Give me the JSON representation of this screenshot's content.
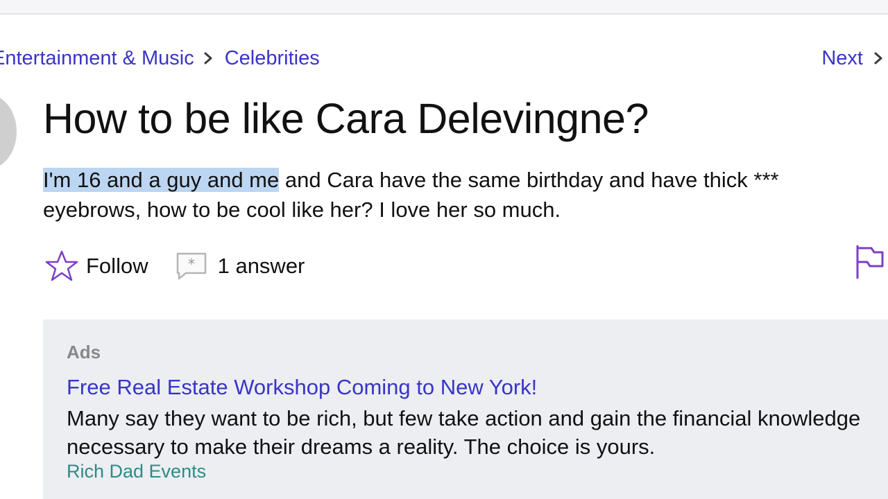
{
  "breadcrumb": {
    "parent": "Entertainment & Music",
    "current": "Celebrities"
  },
  "nav": {
    "next_label": "Next"
  },
  "question": {
    "title": "How to be like Cara Delevingne?",
    "body_selected": "I'm 16 and a guy and me",
    "body_rest": " and Cara have the same birthday and have thick *** eyebrows, how to be cool like her? I love her so much."
  },
  "actions": {
    "follow_label": "Follow",
    "answers_label": "1 answer"
  },
  "ads": {
    "label": "Ads",
    "title": "Free Real Estate Workshop Coming to New York!",
    "description": "Many say they want to be rich, but few take action and gain the financial knowledge necessary to make their dreams a reality. The choice is yours.",
    "source": "Rich Dad Events"
  },
  "icons": {
    "chevron": "chevron-right-icon",
    "follow": "star-icon",
    "answers": "answer-bubble-icon",
    "report": "flag-icon"
  },
  "colors": {
    "link": "#3a34c8",
    "selection": "#bcd6f2",
    "ad_background": "#eceef2",
    "ad_source": "#2e8b84",
    "icon_accent": "#7b3fc4"
  }
}
